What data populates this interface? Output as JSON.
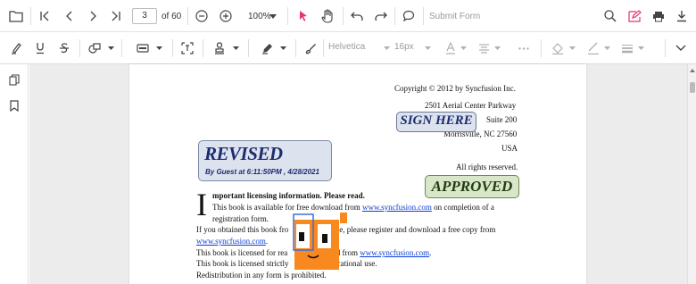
{
  "toolbar": {
    "page_number": "3",
    "page_total": "of 60",
    "zoom_level": "100%",
    "submit_form_label": "Submit Form"
  },
  "annotation_toolbar": {
    "font_family": "Helvetica",
    "font_size": "16px"
  },
  "document": {
    "copyright": "Copyright © 2012 by Syncfusion Inc.",
    "address1": "2501 Aerial Center Parkway",
    "address2": "Suite 200",
    "address3": "Morrisville, NC 27560",
    "country": "USA",
    "rights": "All rights reserved.",
    "dropcap": "I",
    "heading": "mportant licensing information. Please read.",
    "line1_pre": "This book is available for free download from ",
    "line1_link": "www.syncfusion.com",
    "line1_post": " on completion of a",
    "line2": "registration form.",
    "line3_pre": "If you obtained this book fro",
    "line3_post": "e, please register and download a free copy from",
    "line4_link": "www.syncfusion.com",
    "line4_post": ".",
    "line5_pre": "This book is licensed for rea",
    "line5_mid": "ned from ",
    "line5_link": "www.syncfusion.com",
    "line5_post": ".",
    "line6_pre": "This book is licensed strictly",
    "line6_post": "cational use.",
    "line7": "Redistribution in any form is prohibited."
  },
  "stamps": {
    "revised_title": "REVISED",
    "revised_sub": "By Guest at 6:11:50PM , 4/28/2021",
    "sign_here": "SIGN HERE",
    "approved": "APPROVED"
  },
  "colors": {
    "accent": "#e8336b",
    "selection": "#3d6fd8",
    "link": "#0b3fd6",
    "sticker_orange": "#f7891f"
  }
}
